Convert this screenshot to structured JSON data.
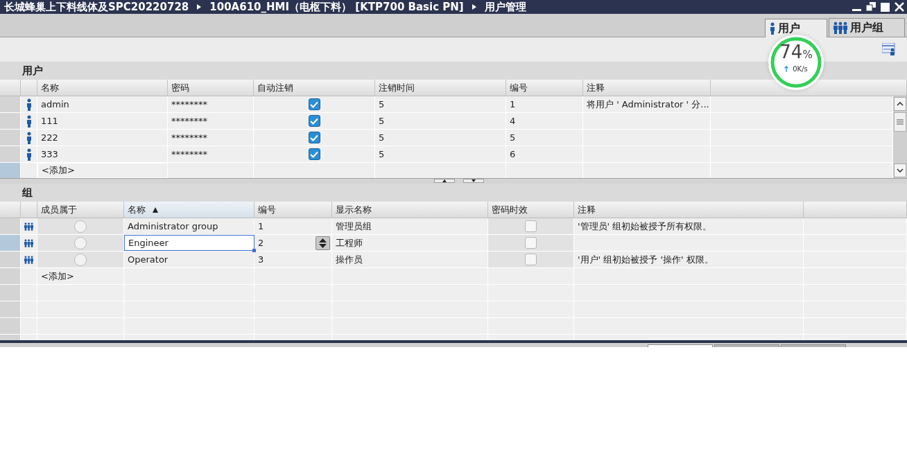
{
  "title_bar": {
    "breadcrumbs": [
      "长城蜂巢上下料线体及SPC20220728",
      "100A610_HMI（电枢下料） [KTP700 Basic PN]",
      "用户管理"
    ]
  },
  "tabs": [
    {
      "label": "用户",
      "kind": "user",
      "selected": true
    },
    {
      "label": "用户组",
      "kind": "group",
      "selected": false
    }
  ],
  "speed_meter": {
    "percent": "74",
    "unit": "%",
    "rate": "0K/s"
  },
  "users": {
    "title": "用户",
    "columns": [
      {
        "label": "名称",
        "sorted": false
      },
      {
        "label": "密码",
        "sorted": false
      },
      {
        "label": "自动注销",
        "sorted": false
      },
      {
        "label": "注销时间",
        "sorted": false
      },
      {
        "label": "编号",
        "sorted": false
      },
      {
        "label": "注释",
        "sorted": false
      }
    ],
    "rows": [
      {
        "name": "admin",
        "password": "********",
        "auto_logoff": true,
        "logoff_time": "5",
        "number": "1",
        "comment": "将用户 ' Administrator ' 分..."
      },
      {
        "name": "111",
        "password": "********",
        "auto_logoff": true,
        "logoff_time": "5",
        "number": "4"
      },
      {
        "name": "222",
        "password": "********",
        "auto_logoff": true,
        "logoff_time": "5",
        "number": "5"
      },
      {
        "name": "333",
        "password": "********",
        "auto_logoff": true,
        "logoff_time": "5",
        "number": "6"
      }
    ],
    "add_row": "<添加>"
  },
  "groups": {
    "title": "组",
    "columns": [
      {
        "label": "成员属于",
        "sorted": false
      },
      {
        "label": "名称",
        "sorted": true
      },
      {
        "label": "编号",
        "sorted": false
      },
      {
        "label": "显示名称",
        "sorted": false
      },
      {
        "label": "密码时效",
        "sorted": false
      },
      {
        "label": "注释",
        "sorted": false
      }
    ],
    "rows": [
      {
        "member": false,
        "name": "Administrator group",
        "number": "1",
        "display_name": "管理员组",
        "password_aging": false,
        "comment": "'管理员' 组初始被授予所有权限。",
        "selected": false
      },
      {
        "member": false,
        "name": "Engineer",
        "number": "2",
        "display_name": "工程师",
        "password_aging": false,
        "selected": true
      },
      {
        "member": false,
        "name": "Operator",
        "number": "3",
        "display_name": "操作员",
        "password_aging": false,
        "comment": "'用户' 组初始被授予 '操作' 权限。",
        "selected": false
      }
    ],
    "add_row": "<添加>"
  },
  "panel_tabs": [
    {
      "selected": true
    },
    {
      "selected": false
    },
    {
      "selected": false
    }
  ]
}
